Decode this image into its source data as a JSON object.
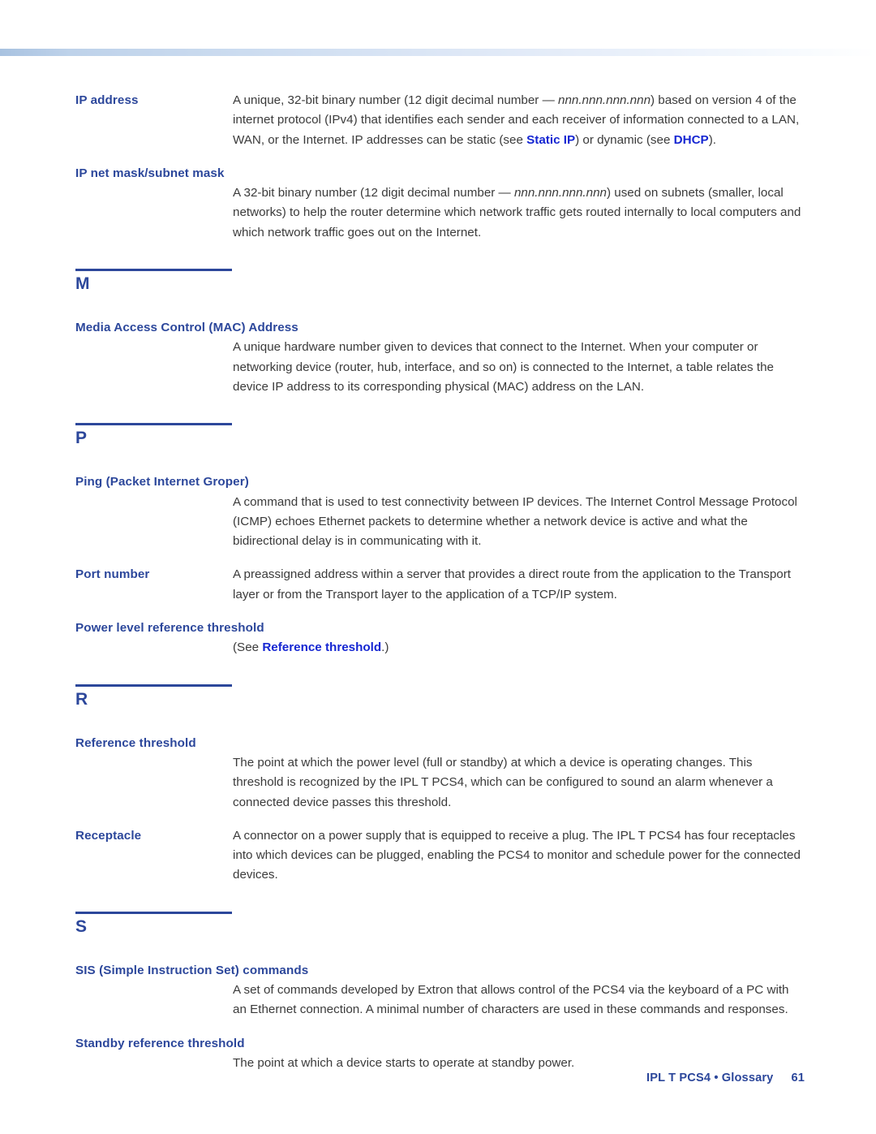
{
  "page": {
    "footer_document": "IPL T PCS4 • Glossary",
    "footer_page_number": "61",
    "accent_heading_color": "#2C479B",
    "accent_link_color": "#1526D2",
    "body_text_color": "#3B3B3B",
    "band_color": "#A8C2E0"
  },
  "entries": [
    {
      "term": "IP address",
      "layout": "inline",
      "definition_parts": [
        {
          "text": "A unique, 32-bit binary number (12 digit decimal number — ",
          "style": "normal"
        },
        {
          "text": "nnn.nnn.nnn.nnn",
          "style": "italic"
        },
        {
          "text": ") based on version 4 of the internet protocol (IPv4) that identifies each sender and each receiver of information connected to a LAN, WAN, or the Internet. IP addresses can be static (see ",
          "style": "normal"
        },
        {
          "text": "Static IP",
          "style": "xref"
        },
        {
          "text": ") or dynamic (see ",
          "style": "normal"
        },
        {
          "text": "DHCP",
          "style": "xref"
        },
        {
          "text": ").",
          "style": "normal"
        }
      ]
    },
    {
      "term": "IP net mask/subnet mask",
      "layout": "block",
      "definition_parts": [
        {
          "text": "A 32-bit binary number (12 digit decimal number — ",
          "style": "normal"
        },
        {
          "text": "nnn.nnn.nnn.nnn",
          "style": "italic"
        },
        {
          "text": ") used on subnets (smaller, local networks) to help the router determine which network traffic gets routed internally to local computers and which network traffic goes out on the Internet.",
          "style": "normal"
        }
      ]
    },
    {
      "term": "Media Access Control (MAC) Address",
      "layout": "block",
      "definition_parts": [
        {
          "text": "A unique hardware number given to devices that connect to the Internet. When your computer or networking device (router, hub, interface, and so on) is connected to the Internet, a table relates the device IP address to its corresponding physical (MAC) address on the LAN.",
          "style": "normal"
        }
      ]
    },
    {
      "term": "Ping (Packet Internet Groper)",
      "layout": "block",
      "definition_parts": [
        {
          "text": "A command that is used to test connectivity between IP devices. The Internet Control Message Protocol (ICMP) echoes Ethernet packets to determine whether a network device is active and what the bidirectional delay is in communicating with it.",
          "style": "normal"
        }
      ]
    },
    {
      "term": "Port number",
      "layout": "inline",
      "definition_parts": [
        {
          "text": "A preassigned address within a server that provides a direct route from the application to the Transport layer or from the Transport layer to the application of a TCP/IP system.",
          "style": "normal"
        }
      ]
    },
    {
      "term": "Power level reference threshold",
      "layout": "block",
      "definition_parts": [
        {
          "text": "(See ",
          "style": "normal"
        },
        {
          "text": "Reference threshold",
          "style": "xref"
        },
        {
          "text": ".)",
          "style": "normal"
        }
      ]
    },
    {
      "term": "Reference threshold",
      "layout": "block",
      "definition_parts": [
        {
          "text": "The point at which the power level (full or standby) at which a device is operating changes. This threshold is recognized by the IPL T PCS4, which can be configured to sound an alarm whenever a connected device passes this threshold.",
          "style": "normal"
        }
      ]
    },
    {
      "term": "Receptacle",
      "layout": "inline",
      "definition_parts": [
        {
          "text": "A connector on a power supply that is equipped to receive a plug. The IPL T PCS4 has four receptacles into which devices can be plugged, enabling the PCS4 to monitor and schedule power for the connected devices.",
          "style": "normal"
        }
      ]
    },
    {
      "term": "SIS (Simple Instruction Set) commands",
      "layout": "block",
      "definition_parts": [
        {
          "text": "A set of commands developed by Extron that allows control of the PCS4 via the keyboard of a PC with an Ethernet connection.  A minimal number of characters are used in these commands and responses.",
          "style": "normal"
        }
      ]
    },
    {
      "term": "Standby reference threshold",
      "layout": "block",
      "definition_parts": [
        {
          "text": "The point at which a device starts to operate at standby power.",
          "style": "normal"
        }
      ]
    }
  ],
  "sections": [
    {
      "letter": "M"
    },
    {
      "letter": "P"
    },
    {
      "letter": "R"
    },
    {
      "letter": "S"
    }
  ],
  "layout_order": [
    {
      "kind": "entry",
      "index": 0
    },
    {
      "kind": "entry",
      "index": 1
    },
    {
      "kind": "section",
      "index": 0
    },
    {
      "kind": "entry",
      "index": 2
    },
    {
      "kind": "section",
      "index": 1
    },
    {
      "kind": "entry",
      "index": 3
    },
    {
      "kind": "entry",
      "index": 4
    },
    {
      "kind": "entry",
      "index": 5
    },
    {
      "kind": "section",
      "index": 2
    },
    {
      "kind": "entry",
      "index": 6
    },
    {
      "kind": "entry",
      "index": 7
    },
    {
      "kind": "section",
      "index": 3
    },
    {
      "kind": "entry",
      "index": 8
    },
    {
      "kind": "entry",
      "index": 9
    }
  ]
}
